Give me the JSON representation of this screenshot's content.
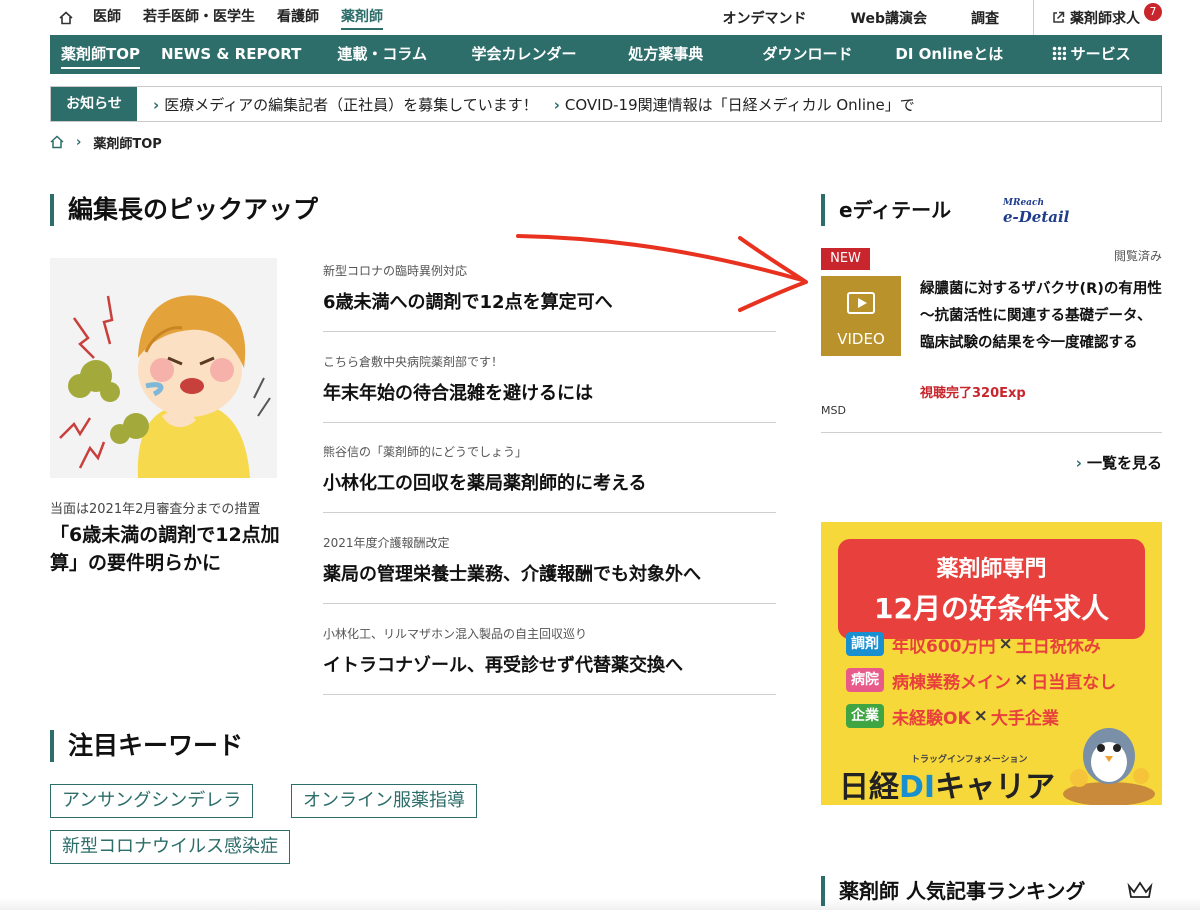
{
  "topbar": {
    "items": [
      "医師",
      "若手医師・医学生",
      "看護師",
      "薬剤師"
    ],
    "right": [
      "オンデマンド",
      "Web講演会",
      "調査"
    ],
    "jobs_label": "薬剤師求人",
    "jobs_badge": "7"
  },
  "mainnav": {
    "items": [
      "薬剤師TOP",
      "NEWS & REPORT",
      "連載・コラム",
      "学会カレンダー",
      "処方薬事典",
      "ダウンロード",
      "DI Onlineとは",
      "サービス"
    ]
  },
  "notice": {
    "label": "お知らせ",
    "items": [
      "医療メディアの編集記者（正社員）を募集しています！",
      "COVID-19関連情報は「日経メディカル Online」で"
    ]
  },
  "breadcrumb": {
    "current": "薬剤師TOP"
  },
  "pickup": {
    "title": "編集長のピックアップ",
    "feature": {
      "caption": "当面は2021年2月審査分までの措置",
      "headline": "「6歳未満の調剤で12点加算」の要件明らかに"
    },
    "articles": [
      {
        "category": "新型コロナの臨時異例対応",
        "headline": "6歳未満への調剤で12点を算定可へ"
      },
      {
        "category": "こちら倉敷中央病院薬剤部です！",
        "headline": "年末年始の待合混雑を避けるには"
      },
      {
        "category": "熊谷信の「薬剤師的にどうでしょう」",
        "headline": "小林化工の回収を薬局薬剤師的に考える"
      },
      {
        "category": "2021年度介護報酬改定",
        "headline": "薬局の管理栄養士業務、介護報酬でも対象外へ"
      },
      {
        "category": "小林化工、リルマザホン混入製品の自主回収巡り",
        "headline": "イトラコナゾール、再受診せず代替薬交換へ"
      }
    ]
  },
  "keywords": {
    "title": "注目キーワード",
    "items": [
      "アンサングシンデレラ",
      "オンライン服薬指導",
      "新型コロナウイルス感染症"
    ]
  },
  "edetail": {
    "title": "eディテール",
    "logo_small": "MReach",
    "logo": "e-Detail",
    "viewed": "閲覧済み",
    "new_tag": "NEW",
    "video_label": "VIDEO",
    "headline": "緑膿菌に対するザバクサ(R)の有用性 〜抗菌活性に関連する基礎データ、臨床試験の結果を今一度確認する",
    "exp": "視聴完了320Exp",
    "company": "MSD",
    "more": "一覧を見る"
  },
  "banner": {
    "line1": "薬剤師専門",
    "line2": "12月の好条件求人",
    "rows": [
      {
        "tag": "調剤",
        "a": "年収600万円",
        "b": "土日祝休み"
      },
      {
        "tag": "病院",
        "a": "病棟業務メイン",
        "b": "日当直なし"
      },
      {
        "tag": "企業",
        "a": "未経験OK",
        "b": "大手企業"
      }
    ],
    "times": "×",
    "small": "トラッグインフォメーション",
    "brand_a": "日経",
    "brand_b": "DI",
    "brand_c": "キャリア"
  },
  "ranking": {
    "title": "薬剤師 人気記事ランキング"
  },
  "colors": {
    "accent": "#2d6d6a",
    "red": "#c8252c",
    "annotation_arrow": "#e8321f"
  },
  "icons": [
    "home-icon",
    "external-link-icon",
    "grid-icon",
    "chevron-right-icon",
    "play-icon",
    "crown-icon"
  ]
}
